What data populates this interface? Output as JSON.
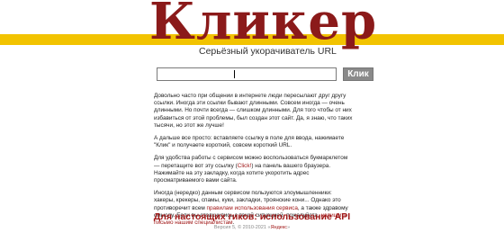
{
  "header": {
    "logo": "Кликер",
    "tagline": "Серьёзный укорачиватель URL"
  },
  "search": {
    "value": "",
    "button_label": "Клик"
  },
  "content": {
    "p1": "Довольно часто при общении в интернете люди пересылают друг другу ссылки. Иногда эти ссылки бывают длинными. Совсем иногда — очень длинными. Но почти всегда — слишком длинными. Для того чтобы от них избавиться от этой проблемы, был создан этот сайт. Да, я знаю, что таких тысячи, но этот же лучше!",
    "p2": "А дальше все просто: вставляете ссылку в поле для ввода, нажимаете \"Клик\" и получаете короткий, совсем короткий URL.",
    "p3_before": "Для удобства работы с сервисом можно воспользоваться букмарклетом — перетащите вот эту ссылку (",
    "p3_link": "Click!",
    "p3_after": ") на панель вашего браузера. Нажимайте на эту закладку, когда хотите укоротить адрес просматриваемого вами сайта.",
    "p4_before": "Иногда (нередко) данным сервисом пользуются злоумышленники: хакеры, крекеры, спамы, куки, закладки, троянские кони... Однако это противоречит всем ",
    "p4_link1": "правилам использования сервиса",
    "p4_mid": ", а также здравому смыслу. Если вы столкнулись с такой ситуацией, пожалуйста, ",
    "p4_link2": "напишите письмо нашим специалистам",
    "p4_end": "."
  },
  "geeks_link": "Для настоящих гиков: использование API",
  "footer": {
    "text": "Версия 5, © 2010-2021 «",
    "yandex": "Яндекс",
    "end": "»"
  }
}
